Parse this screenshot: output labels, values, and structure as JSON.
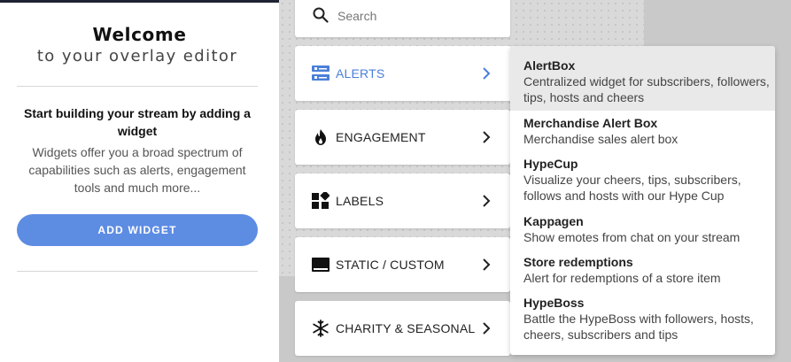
{
  "welcome": {
    "title": "Welcome",
    "subtitle": "to your overlay editor",
    "heading": "Start building your stream by adding a widget",
    "description": "Widgets offer you a broad spectrum of capabilities such as alerts, engagement tools and much more...",
    "add_button": "ADD WIDGET"
  },
  "search": {
    "placeholder": "Search",
    "icon": "search-icon"
  },
  "categories": [
    {
      "label": "ALERTS",
      "icon": "alerts-icon",
      "active": true
    },
    {
      "label": "ENGAGEMENT",
      "icon": "flame-icon",
      "active": false
    },
    {
      "label": "LABELS",
      "icon": "labels-grid-icon",
      "active": false
    },
    {
      "label": "STATIC / CUSTOM",
      "icon": "static-custom-icon",
      "active": false
    },
    {
      "label": "CHARITY & SEASONAL",
      "icon": "snowflake-icon",
      "active": false
    }
  ],
  "widgets": [
    {
      "title": "AlertBox",
      "description": "Centralized widget for subscribers, followers, tips, hosts and cheers",
      "hovered": true
    },
    {
      "title": "Merchandise Alert Box",
      "description": "Merchandise sales alert box"
    },
    {
      "title": "HypeCup",
      "description": "Visualize your cheers, tips, subscribers, follows and hosts with our Hype Cup"
    },
    {
      "title": "Kappagen",
      "description": "Show emotes from chat on your stream"
    },
    {
      "title": "Store redemptions",
      "description": "Alert for redemptions of a store item"
    },
    {
      "title": "HypeBoss",
      "description": "Battle the HypeBoss with followers, hosts, cheers, subscribers and tips"
    }
  ],
  "colors": {
    "accent": "#5d8ce3",
    "active_label": "#4a7fd8",
    "hover_bg": "#e9e9e9",
    "canvas_bg": "#c9c9c9"
  }
}
